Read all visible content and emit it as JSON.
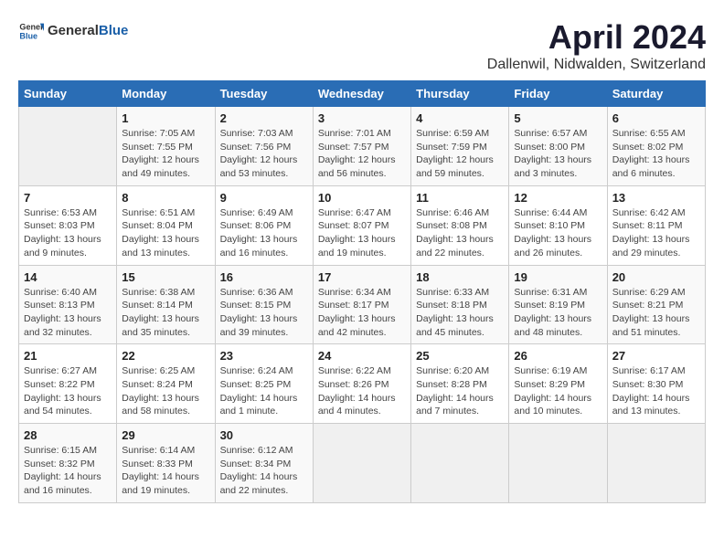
{
  "header": {
    "logo_general": "General",
    "logo_blue": "Blue",
    "month_year": "April 2024",
    "location": "Dallenwil, Nidwalden, Switzerland"
  },
  "days_of_week": [
    "Sunday",
    "Monday",
    "Tuesday",
    "Wednesday",
    "Thursday",
    "Friday",
    "Saturday"
  ],
  "weeks": [
    [
      {
        "day": "",
        "info": ""
      },
      {
        "day": "1",
        "info": "Sunrise: 7:05 AM\nSunset: 7:55 PM\nDaylight: 12 hours\nand 49 minutes."
      },
      {
        "day": "2",
        "info": "Sunrise: 7:03 AM\nSunset: 7:56 PM\nDaylight: 12 hours\nand 53 minutes."
      },
      {
        "day": "3",
        "info": "Sunrise: 7:01 AM\nSunset: 7:57 PM\nDaylight: 12 hours\nand 56 minutes."
      },
      {
        "day": "4",
        "info": "Sunrise: 6:59 AM\nSunset: 7:59 PM\nDaylight: 12 hours\nand 59 minutes."
      },
      {
        "day": "5",
        "info": "Sunrise: 6:57 AM\nSunset: 8:00 PM\nDaylight: 13 hours\nand 3 minutes."
      },
      {
        "day": "6",
        "info": "Sunrise: 6:55 AM\nSunset: 8:02 PM\nDaylight: 13 hours\nand 6 minutes."
      }
    ],
    [
      {
        "day": "7",
        "info": "Sunrise: 6:53 AM\nSunset: 8:03 PM\nDaylight: 13 hours\nand 9 minutes."
      },
      {
        "day": "8",
        "info": "Sunrise: 6:51 AM\nSunset: 8:04 PM\nDaylight: 13 hours\nand 13 minutes."
      },
      {
        "day": "9",
        "info": "Sunrise: 6:49 AM\nSunset: 8:06 PM\nDaylight: 13 hours\nand 16 minutes."
      },
      {
        "day": "10",
        "info": "Sunrise: 6:47 AM\nSunset: 8:07 PM\nDaylight: 13 hours\nand 19 minutes."
      },
      {
        "day": "11",
        "info": "Sunrise: 6:46 AM\nSunset: 8:08 PM\nDaylight: 13 hours\nand 22 minutes."
      },
      {
        "day": "12",
        "info": "Sunrise: 6:44 AM\nSunset: 8:10 PM\nDaylight: 13 hours\nand 26 minutes."
      },
      {
        "day": "13",
        "info": "Sunrise: 6:42 AM\nSunset: 8:11 PM\nDaylight: 13 hours\nand 29 minutes."
      }
    ],
    [
      {
        "day": "14",
        "info": "Sunrise: 6:40 AM\nSunset: 8:13 PM\nDaylight: 13 hours\nand 32 minutes."
      },
      {
        "day": "15",
        "info": "Sunrise: 6:38 AM\nSunset: 8:14 PM\nDaylight: 13 hours\nand 35 minutes."
      },
      {
        "day": "16",
        "info": "Sunrise: 6:36 AM\nSunset: 8:15 PM\nDaylight: 13 hours\nand 39 minutes."
      },
      {
        "day": "17",
        "info": "Sunrise: 6:34 AM\nSunset: 8:17 PM\nDaylight: 13 hours\nand 42 minutes."
      },
      {
        "day": "18",
        "info": "Sunrise: 6:33 AM\nSunset: 8:18 PM\nDaylight: 13 hours\nand 45 minutes."
      },
      {
        "day": "19",
        "info": "Sunrise: 6:31 AM\nSunset: 8:19 PM\nDaylight: 13 hours\nand 48 minutes."
      },
      {
        "day": "20",
        "info": "Sunrise: 6:29 AM\nSunset: 8:21 PM\nDaylight: 13 hours\nand 51 minutes."
      }
    ],
    [
      {
        "day": "21",
        "info": "Sunrise: 6:27 AM\nSunset: 8:22 PM\nDaylight: 13 hours\nand 54 minutes."
      },
      {
        "day": "22",
        "info": "Sunrise: 6:25 AM\nSunset: 8:24 PM\nDaylight: 13 hours\nand 58 minutes."
      },
      {
        "day": "23",
        "info": "Sunrise: 6:24 AM\nSunset: 8:25 PM\nDaylight: 14 hours\nand 1 minute."
      },
      {
        "day": "24",
        "info": "Sunrise: 6:22 AM\nSunset: 8:26 PM\nDaylight: 14 hours\nand 4 minutes."
      },
      {
        "day": "25",
        "info": "Sunrise: 6:20 AM\nSunset: 8:28 PM\nDaylight: 14 hours\nand 7 minutes."
      },
      {
        "day": "26",
        "info": "Sunrise: 6:19 AM\nSunset: 8:29 PM\nDaylight: 14 hours\nand 10 minutes."
      },
      {
        "day": "27",
        "info": "Sunrise: 6:17 AM\nSunset: 8:30 PM\nDaylight: 14 hours\nand 13 minutes."
      }
    ],
    [
      {
        "day": "28",
        "info": "Sunrise: 6:15 AM\nSunset: 8:32 PM\nDaylight: 14 hours\nand 16 minutes."
      },
      {
        "day": "29",
        "info": "Sunrise: 6:14 AM\nSunset: 8:33 PM\nDaylight: 14 hours\nand 19 minutes."
      },
      {
        "day": "30",
        "info": "Sunrise: 6:12 AM\nSunset: 8:34 PM\nDaylight: 14 hours\nand 22 minutes."
      },
      {
        "day": "",
        "info": ""
      },
      {
        "day": "",
        "info": ""
      },
      {
        "day": "",
        "info": ""
      },
      {
        "day": "",
        "info": ""
      }
    ]
  ]
}
